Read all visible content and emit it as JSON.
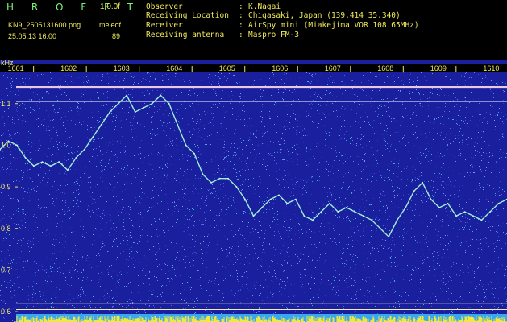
{
  "header": {
    "app_title": "H R O F F T",
    "speed": "1.0.0f",
    "file_name": "KN9_2505131600.png",
    "mode": "meleof",
    "datetime": "25.05.13 16:00",
    "count": "89",
    "info": [
      {
        "label": "Observer",
        "value": "K.Nagai"
      },
      {
        "label": "Receiving Location",
        "value": "Chigasaki, Japan (139.414 35.340)"
      },
      {
        "label": "Receiver",
        "value": "AirSpy mini (Miakejima VOR 108.65MHz)"
      },
      {
        "label": "Receiving antenna",
        "value": "Maspro FM-3"
      }
    ],
    "separator": ":"
  },
  "colors": {
    "background": "#1a1f9e",
    "text": "#f0e85a",
    "title": "#7cf07c",
    "trace": "#9ef0d6"
  },
  "chart_data": {
    "type": "line",
    "title": "",
    "xlabel": "",
    "ylabel": "kHz",
    "x_tick_labels": [
      "1601",
      "1602",
      "1603",
      "1604",
      "1605",
      "1606",
      "1607",
      "1608",
      "1609",
      "1610"
    ],
    "x_ticks": [
      1601,
      1602,
      1603,
      1604,
      1605,
      1606,
      1607,
      1608,
      1609,
      1610
    ],
    "xlim": [
      1600.7,
      1610.3
    ],
    "y_tick_labels": [
      "0.6",
      "0.7",
      "0.8",
      "0.9",
      "1.0",
      "1.1"
    ],
    "y_ticks": [
      0.6,
      0.7,
      0.8,
      0.9,
      1.0,
      1.1
    ],
    "ylim": [
      0.575,
      1.175
    ],
    "grid": false,
    "carrier_lines": [
      1.14,
      1.105,
      0.62,
      0.605
    ],
    "series": [
      {
        "x": [
          1600.7,
          1600.86,
          1601.02,
          1601.18,
          1601.34,
          1601.5,
          1601.66,
          1601.82,
          1601.98,
          1602.14,
          1602.3,
          1602.46,
          1602.62,
          1602.78,
          1602.94,
          1603.1,
          1603.26,
          1603.42,
          1603.58,
          1603.74,
          1603.9,
          1604.06,
          1604.22,
          1604.38,
          1604.54,
          1604.7,
          1604.86,
          1605.02,
          1605.18,
          1605.34,
          1605.5,
          1605.66,
          1605.82,
          1605.98,
          1606.14,
          1606.3,
          1606.46,
          1606.62,
          1606.78,
          1606.94,
          1607.1,
          1607.26,
          1607.42,
          1607.58,
          1607.74,
          1607.9,
          1608.06,
          1608.22,
          1608.38,
          1608.54,
          1608.7,
          1608.86,
          1609.02,
          1609.18,
          1609.34,
          1609.5,
          1609.66,
          1609.82,
          1609.98,
          1610.14,
          1610.3
        ],
        "y": [
          0.99,
          1.01,
          1.0,
          0.97,
          0.95,
          0.96,
          0.95,
          0.96,
          0.94,
          0.97,
          0.99,
          1.02,
          1.05,
          1.08,
          1.1,
          1.12,
          1.08,
          1.09,
          1.1,
          1.12,
          1.1,
          1.05,
          1.0,
          0.98,
          0.93,
          0.91,
          0.92,
          0.92,
          0.9,
          0.87,
          0.83,
          0.85,
          0.87,
          0.88,
          0.86,
          0.87,
          0.83,
          0.82,
          0.84,
          0.86,
          0.84,
          0.85,
          0.84,
          0.83,
          0.82,
          0.8,
          0.78,
          0.82,
          0.85,
          0.89,
          0.91,
          0.87,
          0.85,
          0.86,
          0.83,
          0.84,
          0.83,
          0.82,
          0.84,
          0.86,
          0.87
        ]
      }
    ]
  }
}
